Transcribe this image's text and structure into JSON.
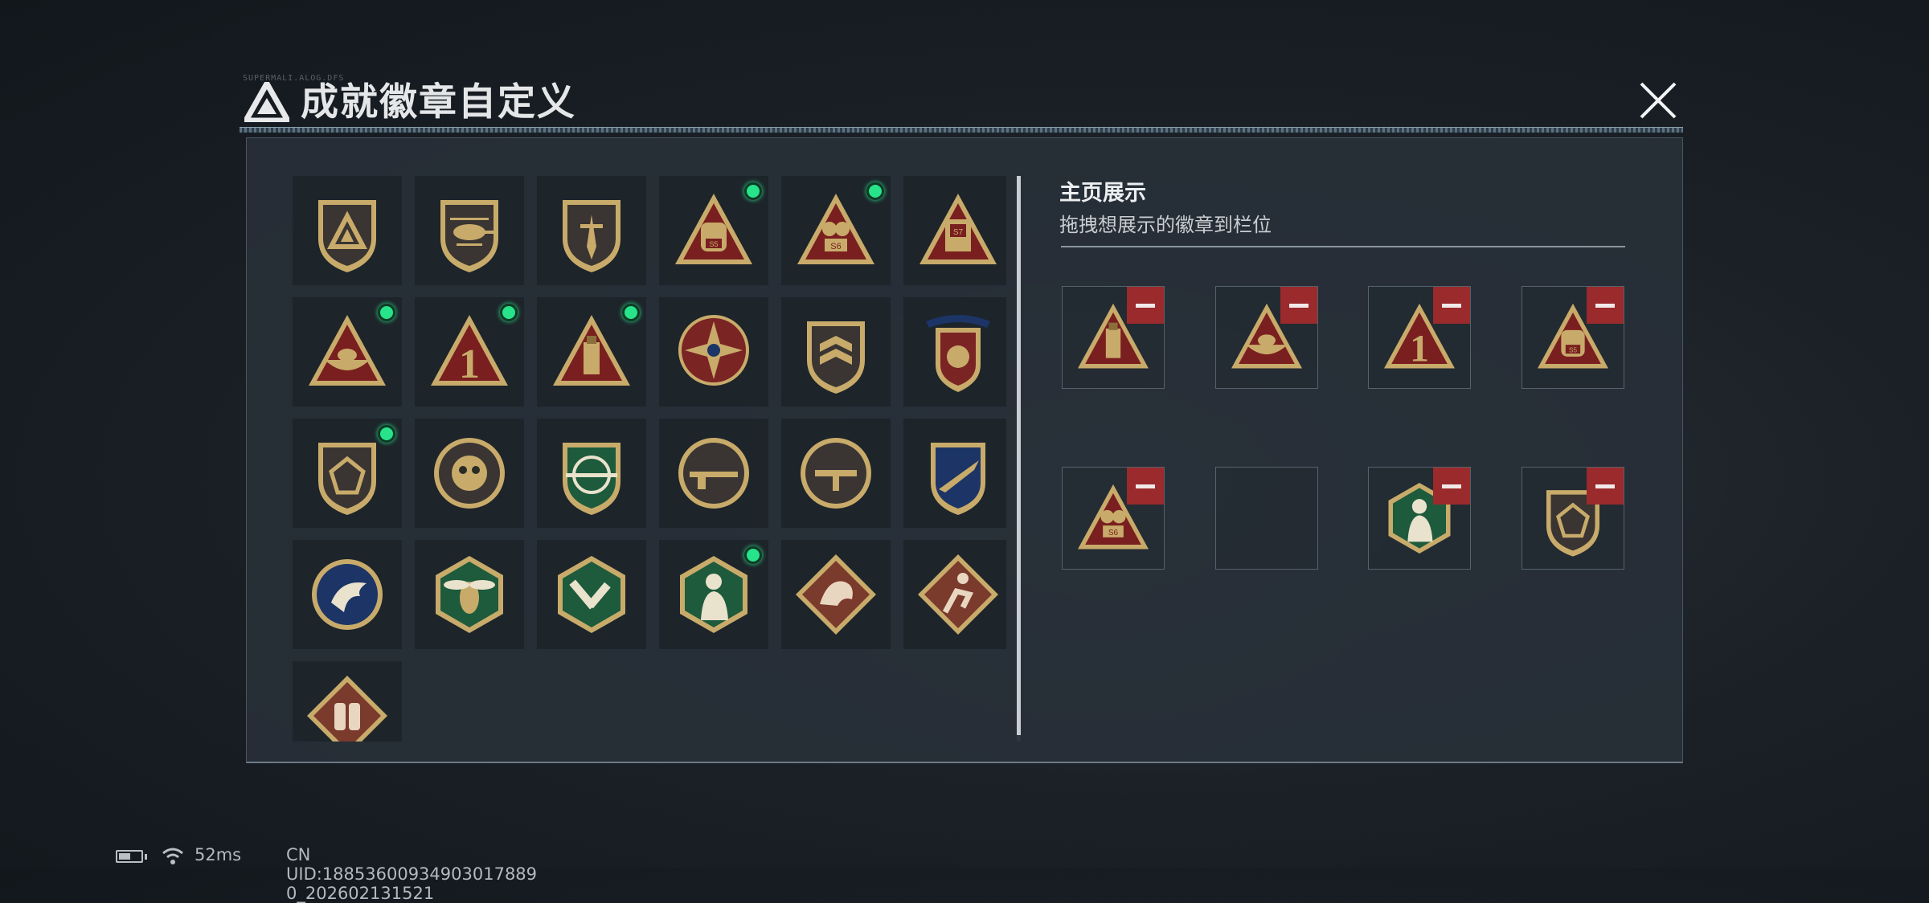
{
  "window": {
    "title": "成就徽章自定义",
    "decor_text": "SUPERMALI.ALOG.DFS"
  },
  "colors": {
    "accent_green": "#27e389",
    "remove_red": "#9a2a2c",
    "badge_gold": "#c8ab6a",
    "badge_red": "#7a1f1f",
    "badge_green": "#1e5a3c",
    "badge_navy": "#1c3566"
  },
  "badge_grid": {
    "items": [
      {
        "icon": "triangle-logo-shield-badge",
        "equipped": false
      },
      {
        "icon": "helicopter-shield-badge",
        "equipped": false
      },
      {
        "icon": "dagger-shield-badge",
        "equipped": false
      },
      {
        "icon": "backpack-s5-triangle-badge",
        "equipped": true
      },
      {
        "icon": "s6-triangle-badge",
        "equipped": true
      },
      {
        "icon": "s7-triangle-badge",
        "equipped": false
      },
      {
        "icon": "boat-triangle-badge",
        "equipped": true
      },
      {
        "icon": "number-one-triangle-badge",
        "equipped": true
      },
      {
        "icon": "usb-triangle-badge",
        "equipped": true
      },
      {
        "icon": "star-compass-badge",
        "equipped": false
      },
      {
        "icon": "chevron-shield-badge",
        "equipped": false
      },
      {
        "icon": "laurel-winged-badge",
        "equipped": false
      },
      {
        "icon": "dice-shield-badge",
        "equipped": true
      },
      {
        "icon": "skull-gear-badge",
        "equipped": false
      },
      {
        "icon": "sniper-green-shield-badge",
        "equipped": false
      },
      {
        "icon": "rifle-circle-badge",
        "equipped": false
      },
      {
        "icon": "smg-circle-badge",
        "equipped": false
      },
      {
        "icon": "jet-laurel-badge",
        "equipped": false
      },
      {
        "icon": "eagle-circle-badge",
        "equipped": false
      },
      {
        "icon": "wasp-hexagon-badge",
        "equipped": false
      },
      {
        "icon": "tool-hexagon-badge",
        "equipped": false
      },
      {
        "icon": "soldier-hexagon-badge",
        "equipped": true
      },
      {
        "icon": "dragon-diamond-badge",
        "equipped": false
      },
      {
        "icon": "runner-diamond-badge",
        "equipped": false
      },
      {
        "icon": "supply-diamond-badge",
        "equipped": false
      }
    ]
  },
  "showcase": {
    "title": "主页展示",
    "subtitle": "拖拽想展示的徽章到栏位",
    "slots": [
      {
        "icon": "usb-triangle-badge",
        "removable": true
      },
      {
        "icon": "boat-triangle-badge",
        "removable": true
      },
      {
        "icon": "number-one-triangle-badge",
        "removable": true
      },
      {
        "icon": "backpack-s5-triangle-badge",
        "removable": true
      },
      {
        "icon": "s6-triangle-badge",
        "removable": true
      },
      {
        "icon": "empty-slot",
        "removable": false
      },
      {
        "icon": "soldier-hexagon-badge",
        "removable": true
      },
      {
        "icon": "dice-shield-badge",
        "removable": true
      }
    ]
  },
  "status_bar": {
    "battery_icon": "battery-icon",
    "wifi_icon": "wifi-icon",
    "ping": "52ms",
    "uid": "CN UID:18853600934903017889​0_202602131521"
  }
}
